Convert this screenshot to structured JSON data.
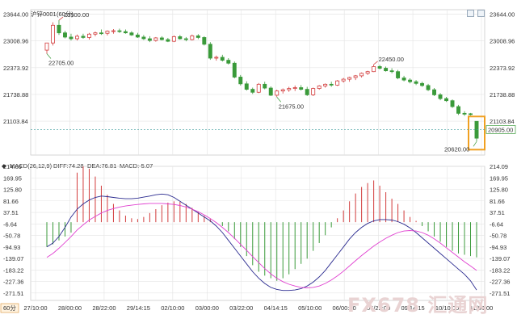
{
  "chart_data": {
    "type": "candlestick",
    "symbol": "沪锌0001",
    "period": "(60分)",
    "macd_header": "MACD(26,12,9)",
    "macd_values": {
      "diff": "DIFF:74.28",
      "dea": "DEA:76.81",
      "macd": "MACD:-5.07"
    },
    "price_axis": {
      "ticks": [
        "23644.00",
        "23008.96",
        "22373.92",
        "21738.88",
        "21103.84",
        "20620.00"
      ],
      "ylim": [
        20300,
        23750
      ]
    },
    "macd_axis": {
      "ticks": [
        "214.09",
        "169.95",
        "125.80",
        "81.66",
        "37.51",
        "-6.64",
        "-50.78",
        "-94.93",
        "-139.07",
        "-183.22",
        "-227.36",
        "-271.51"
      ],
      "ylim": [
        -300,
        214.09
      ]
    },
    "x_ticks": [
      "27/10:00",
      "28/00:00",
      "28/22:00",
      "29/14:15",
      "02/10:00",
      "03/00:00",
      "03/22:00",
      "04/14:15",
      "05/10:00",
      "06/00:00",
      "06/22:00",
      "09/14:15",
      "10/10:00",
      "11/00:00"
    ],
    "current_price": "20905.00",
    "annotations": [
      {
        "text": "23500.00",
        "color": "#d23c3c"
      },
      {
        "text": "22705.00",
        "color": "#3a9a3a"
      },
      {
        "text": "22450.00",
        "color": "#d23c3c"
      },
      {
        "text": "21675.00",
        "color": "#3a9a3a"
      },
      {
        "text": "20620.00",
        "color": "#3a9a3a"
      }
    ],
    "candles": [
      [
        22790,
        22960,
        22700,
        22960
      ],
      [
        22960,
        23450,
        22900,
        23380
      ],
      [
        23380,
        23500,
        23150,
        23200
      ],
      [
        23200,
        23250,
        23070,
        23100
      ],
      [
        23100,
        23180,
        23020,
        23060
      ],
      [
        23060,
        23160,
        23020,
        23120
      ],
      [
        23120,
        23180,
        23060,
        23090
      ],
      [
        23090,
        23200,
        23040,
        23170
      ],
      [
        23170,
        23230,
        23120,
        23200
      ],
      [
        23200,
        23280,
        23150,
        23190
      ],
      [
        23190,
        23260,
        23140,
        23240
      ],
      [
        23240,
        23290,
        23180,
        23250
      ],
      [
        23250,
        23300,
        23200,
        23230
      ],
      [
        23230,
        23280,
        23180,
        23200
      ],
      [
        23200,
        23240,
        23130,
        23150
      ],
      [
        23150,
        23200,
        23080,
        23100
      ],
      [
        23100,
        23150,
        23030,
        23060
      ],
      [
        23060,
        23120,
        22980,
        23020
      ],
      [
        23020,
        23100,
        22990,
        23080
      ],
      [
        23080,
        23120,
        23020,
        23040
      ],
      [
        23040,
        23080,
        22980,
        23000
      ],
      [
        23000,
        23140,
        22980,
        23110
      ],
      [
        23110,
        23150,
        23040,
        23060
      ],
      [
        23060,
        23100,
        23000,
        23040
      ],
      [
        23040,
        23160,
        23020,
        23130
      ],
      [
        23130,
        23170,
        23050,
        23090
      ],
      [
        23090,
        23120,
        22900,
        22930
      ],
      [
        22930,
        22980,
        22560,
        22600
      ],
      [
        22600,
        22660,
        22540,
        22620
      ],
      [
        22620,
        22680,
        22520,
        22550
      ],
      [
        22550,
        22600,
        22450,
        22480
      ],
      [
        22480,
        22520,
        22120,
        22150
      ],
      [
        22150,
        22200,
        21950,
        21990
      ],
      [
        21990,
        22050,
        21830,
        21860
      ],
      [
        21860,
        21900,
        21750,
        21790
      ],
      [
        21790,
        22010,
        21770,
        21980
      ],
      [
        21980,
        22040,
        21860,
        21890
      ],
      [
        21890,
        21930,
        21700,
        21720
      ],
      [
        21720,
        21850,
        21675,
        21820
      ],
      [
        21820,
        21880,
        21760,
        21850
      ],
      [
        21850,
        21920,
        21800,
        21880
      ],
      [
        21880,
        21950,
        21820,
        21900
      ],
      [
        21900,
        21960,
        21830,
        21860
      ],
      [
        21860,
        21920,
        21700,
        21730
      ],
      [
        21730,
        21900,
        21700,
        21880
      ],
      [
        21880,
        21960,
        21850,
        21940
      ],
      [
        21940,
        22000,
        21900,
        21980
      ],
      [
        21980,
        22040,
        21920,
        21960
      ],
      [
        21960,
        22080,
        21940,
        22060
      ],
      [
        22060,
        22130,
        22020,
        22100
      ],
      [
        22100,
        22160,
        22040,
        22140
      ],
      [
        22140,
        22200,
        22080,
        22180
      ],
      [
        22180,
        22260,
        22140,
        22240
      ],
      [
        22240,
        22300,
        22200,
        22280
      ],
      [
        22280,
        22450,
        22270,
        22400
      ],
      [
        22400,
        22440,
        22330,
        22360
      ],
      [
        22360,
        22400,
        22280,
        22300
      ],
      [
        22300,
        22360,
        22240,
        22280
      ],
      [
        22280,
        22320,
        22100,
        22130
      ],
      [
        22130,
        22180,
        22050,
        22080
      ],
      [
        22080,
        22120,
        22000,
        22040
      ],
      [
        22040,
        22080,
        21960,
        22000
      ],
      [
        22000,
        22040,
        21920,
        21950
      ],
      [
        21950,
        21990,
        21820,
        21850
      ],
      [
        21850,
        21890,
        21700,
        21730
      ],
      [
        21730,
        21770,
        21600,
        21640
      ],
      [
        21640,
        21680,
        21560,
        21590
      ],
      [
        21590,
        21620,
        21420,
        21450
      ],
      [
        21450,
        21490,
        21250,
        21290
      ],
      [
        21290,
        21340,
        21230,
        21280
      ],
      [
        21280,
        21300,
        21240,
        21270
      ],
      [
        21100,
        21100,
        20620,
        20700
      ]
    ],
    "macd_bars": [
      -95,
      -85,
      -70,
      -55,
      -40,
      190,
      214,
      205,
      175,
      140,
      105,
      70,
      45,
      25,
      15,
      12,
      20,
      35,
      50,
      65,
      75,
      80,
      78,
      70,
      55,
      40,
      25,
      12,
      0,
      -15,
      -35,
      -65,
      -95,
      -130,
      -165,
      -190,
      -205,
      -215,
      -225,
      -215,
      -200,
      -180,
      -160,
      -140,
      -110,
      -80,
      -50,
      -20,
      15,
      45,
      80,
      110,
      135,
      150,
      160,
      140,
      115,
      90,
      70,
      45,
      20,
      5,
      -15,
      -35,
      -55,
      -75,
      -95,
      -110,
      -120,
      -125,
      -130,
      -135
    ],
    "diff_line": [
      -95,
      -80,
      -55,
      -20,
      20,
      50,
      70,
      85,
      95,
      100,
      98,
      95,
      92,
      90,
      90,
      92,
      96,
      100,
      105,
      108,
      105,
      95,
      80,
      65,
      50,
      35,
      20,
      5,
      -15,
      -40,
      -70,
      -100,
      -130,
      -160,
      -190,
      -215,
      -235,
      -250,
      -258,
      -262,
      -262,
      -260,
      -255,
      -245,
      -230,
      -210,
      -185,
      -155,
      -125,
      -95,
      -65,
      -40,
      -20,
      -5,
      5,
      10,
      10,
      8,
      2,
      -8,
      -22,
      -40,
      -60,
      -80,
      -100,
      -120,
      -140,
      -160,
      -180,
      -200,
      -225,
      -260
    ],
    "dea_line": [
      -135,
      -120,
      -100,
      -78,
      -55,
      -30,
      -10,
      8,
      22,
      35,
      45,
      52,
      58,
      62,
      65,
      68,
      70,
      72,
      72,
      72,
      70,
      68,
      64,
      58,
      50,
      40,
      28,
      14,
      -2,
      -20,
      -40,
      -62,
      -85,
      -108,
      -132,
      -155,
      -178,
      -198,
      -215,
      -228,
      -238,
      -245,
      -250,
      -252,
      -250,
      -245,
      -235,
      -222,
      -206,
      -188,
      -168,
      -148,
      -128,
      -110,
      -92,
      -76,
      -62,
      -50,
      -40,
      -34,
      -32,
      -34,
      -40,
      -50,
      -64,
      -80,
      -98,
      -116,
      -134,
      -152,
      -168,
      -185
    ]
  },
  "ui": {
    "watermark_text": "FX678 汇通网",
    "period_button": "60分",
    "colors": {
      "up": "#d23c3c",
      "down": "#3a9a3a",
      "diff": "#2a2a8f",
      "dea": "#e040d0",
      "grid": "#e4e4e4",
      "highlight": "#f0a020"
    }
  }
}
